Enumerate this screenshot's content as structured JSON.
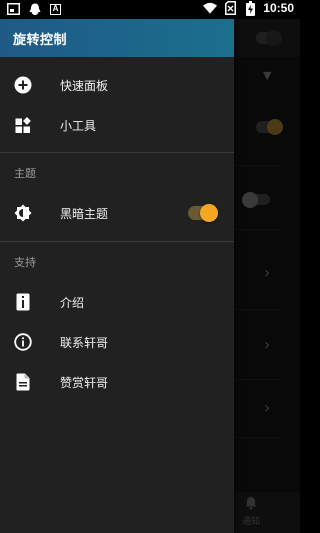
{
  "status_bar": {
    "time": "10:50",
    "notification_letter": "A",
    "battery_icon": "battery-charging-icon",
    "wifi_icon": "wifi-icon",
    "sim_icon": "no-sim-icon"
  },
  "drawer": {
    "title": "旋转控制",
    "items": [
      {
        "label": "快速面板",
        "icon": "add-circle-icon"
      },
      {
        "label": "小工具",
        "icon": "widgets-icon"
      }
    ],
    "sections": [
      {
        "title": "主题",
        "items": [
          {
            "label": "黑暗主题",
            "icon": "brightness-icon",
            "toggle_on": true
          }
        ]
      },
      {
        "title": "支持",
        "items": [
          {
            "label": "介绍",
            "icon": "info-box-icon"
          },
          {
            "label": "联系轩哥",
            "icon": "info-circle-icon"
          },
          {
            "label": "赞赏轩哥",
            "icon": "document-icon"
          }
        ]
      }
    ]
  },
  "background": {
    "bottom_nav_label": "通知"
  },
  "colors": {
    "header": "#1b6f8e",
    "drawer_bg": "#212121",
    "accent": "#f5a623"
  }
}
